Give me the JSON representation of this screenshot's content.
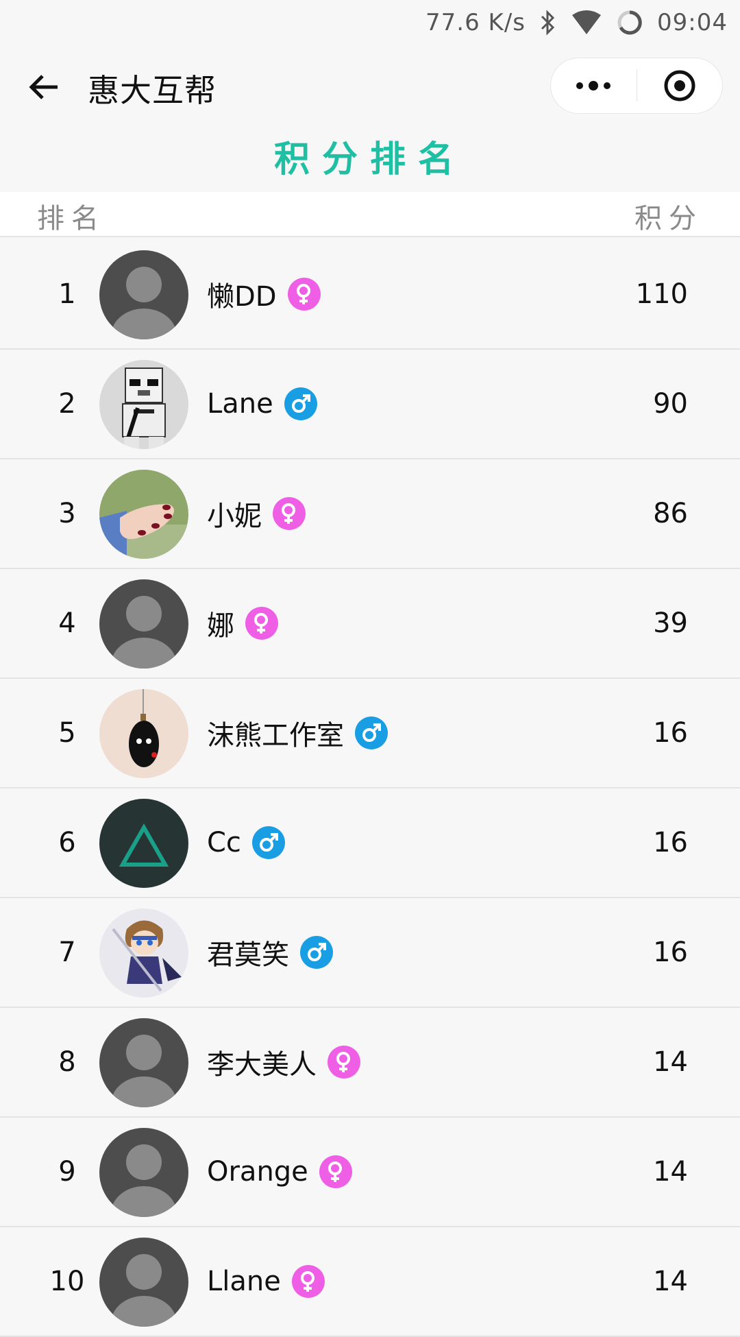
{
  "status_bar": {
    "speed": "77.6 K/s",
    "time": "09:04",
    "icons": [
      "bluetooth-icon",
      "wifi-icon",
      "loading-icon"
    ]
  },
  "nav": {
    "title": "惠大互帮",
    "back_icon": "back-arrow-icon",
    "menu_icon": "more-dots-icon",
    "close_icon": "target-circle-icon"
  },
  "page": {
    "title": "积分排名"
  },
  "table": {
    "header_rank": "排名",
    "header_score": "积分"
  },
  "colors": {
    "accent": "#1fbfa4",
    "female": "#ee5fe6",
    "male": "#1a9ee3"
  },
  "rows": [
    {
      "rank": "1",
      "name": "懒DD",
      "gender": "female",
      "score": "110",
      "avatar": "default-avatar"
    },
    {
      "rank": "2",
      "name": "Lane",
      "gender": "male",
      "score": "90",
      "avatar": "stormtrooper-avatar"
    },
    {
      "rank": "3",
      "name": "小妮",
      "gender": "female",
      "score": "86",
      "avatar": "hand-nails-avatar"
    },
    {
      "rank": "4",
      "name": "娜",
      "gender": "female",
      "score": "39",
      "avatar": "default-avatar"
    },
    {
      "rank": "5",
      "name": "沫熊工作室",
      "gender": "male",
      "score": "16",
      "avatar": "bear-ornament-avatar"
    },
    {
      "rank": "6",
      "name": "Cc",
      "gender": "male",
      "score": "16",
      "avatar": "triangle-avatar"
    },
    {
      "rank": "7",
      "name": "君莫笑",
      "gender": "male",
      "score": "16",
      "avatar": "anime-warrior-avatar"
    },
    {
      "rank": "8",
      "name": "李大美人",
      "gender": "female",
      "score": "14",
      "avatar": "default-avatar"
    },
    {
      "rank": "9",
      "name": "Orange",
      "gender": "female",
      "score": "14",
      "avatar": "default-avatar"
    },
    {
      "rank": "10",
      "name": "Llane",
      "gender": "female",
      "score": "14",
      "avatar": "default-avatar"
    }
  ]
}
